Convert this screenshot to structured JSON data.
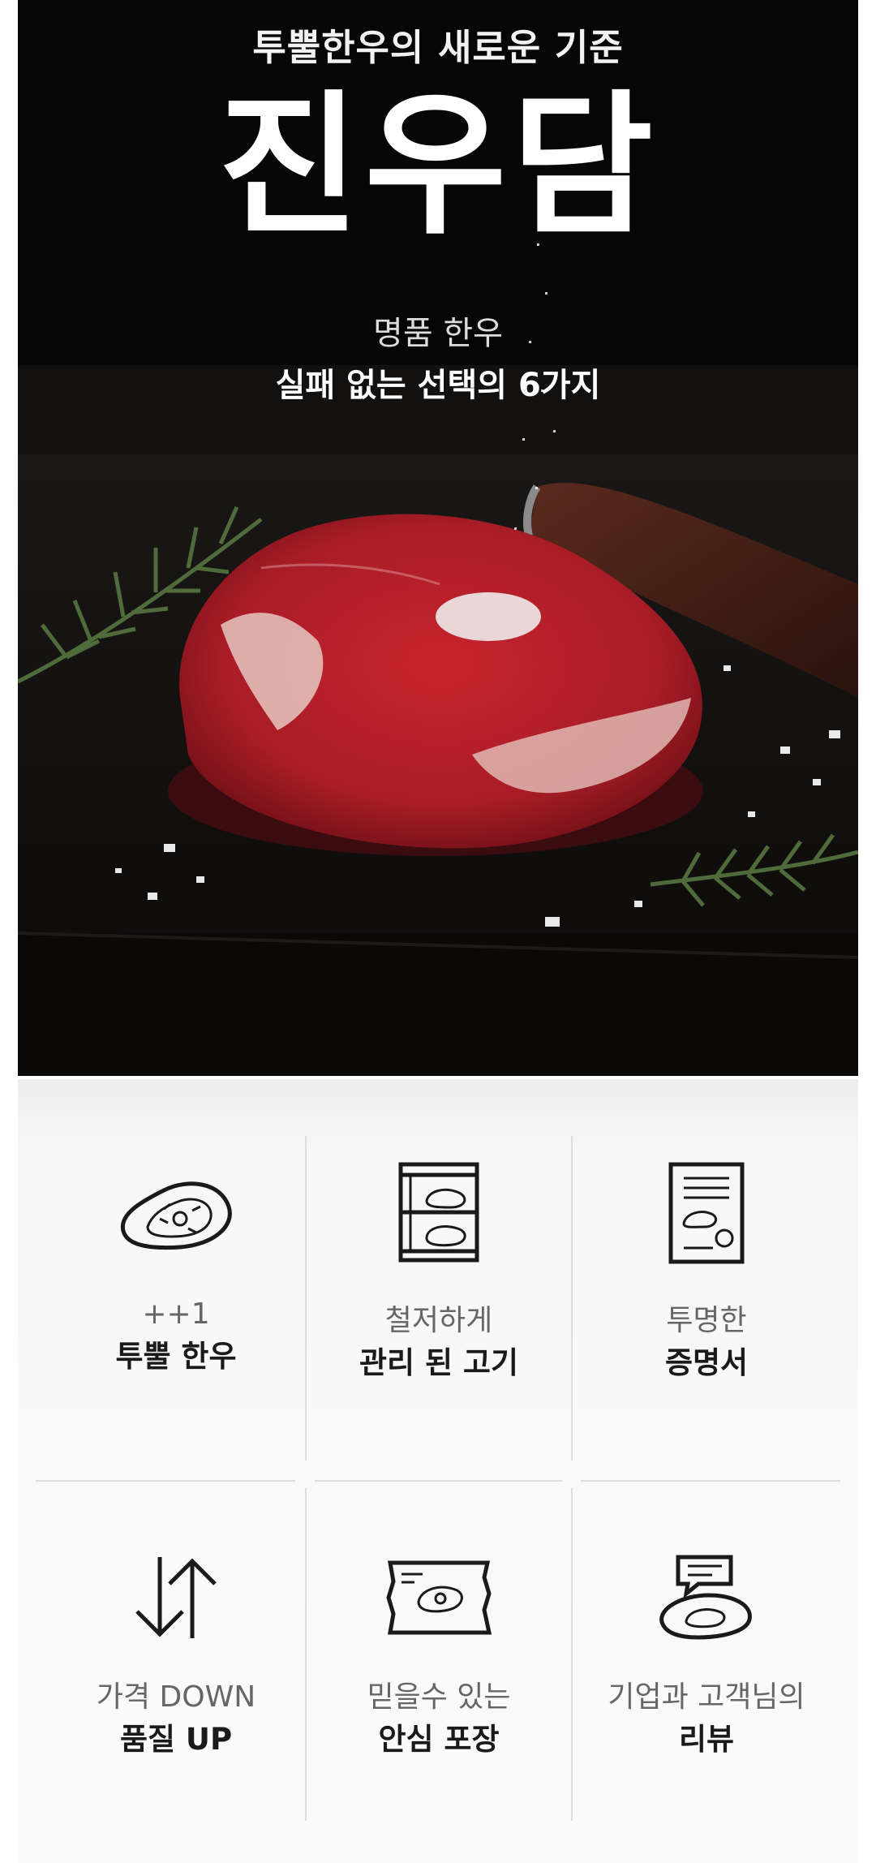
{
  "hero": {
    "subtitle": "투뿔한우의 새로운 기준",
    "brand": "진우담",
    "tagline": "명품 한우",
    "tagline_bold": "실패 없는 선택의 6가지"
  },
  "features": [
    {
      "line1": "++1",
      "line2": "투뿔 한우",
      "icon": "steak-icon"
    },
    {
      "line1": "철저하게",
      "line2": "관리 된 고기",
      "icon": "aging-fridge-icon"
    },
    {
      "line1": "투명한",
      "line2": "증명서",
      "icon": "certificate-icon"
    },
    {
      "line1": "가격 DOWN",
      "line2": "품질 UP",
      "icon": "up-down-arrows-icon"
    },
    {
      "line1": "믿을수 있는",
      "line2": "안심 포장",
      "icon": "package-icon"
    },
    {
      "line1": "기업과 고객님의",
      "line2": "리뷰",
      "icon": "review-icon"
    }
  ],
  "colors": {
    "hero_bg": "#050505",
    "meat_red": "#b3202a",
    "panel_bg": "#f8f8f8"
  }
}
